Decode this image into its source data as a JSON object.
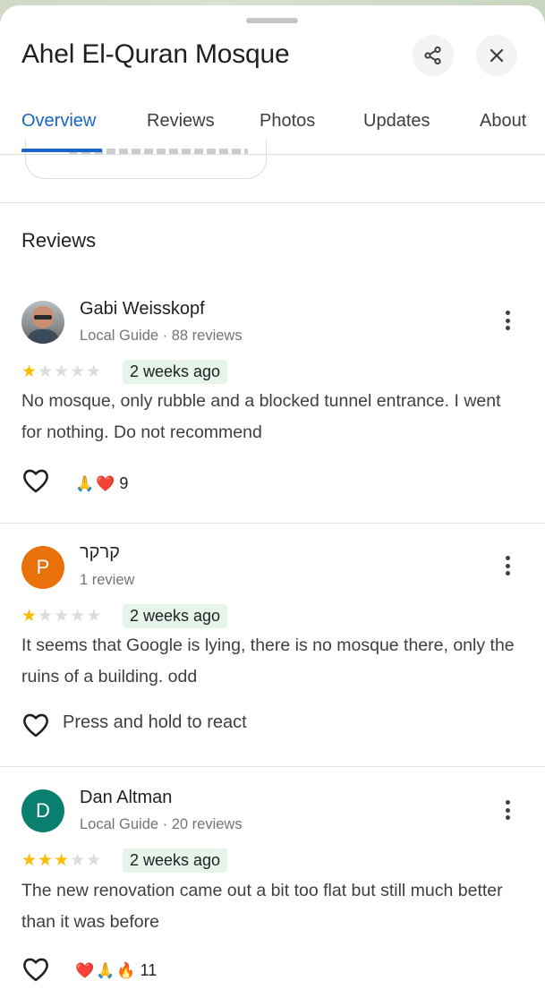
{
  "place": {
    "title": "Ahel El-Quran Mosque"
  },
  "tabs": [
    {
      "label": "Overview",
      "active": true
    },
    {
      "label": "Reviews",
      "active": false
    },
    {
      "label": "Photos",
      "active": false
    },
    {
      "label": "Updates",
      "active": false
    },
    {
      "label": "About",
      "active": false
    }
  ],
  "section": {
    "title": "Reviews"
  },
  "colors": {
    "accent": "#1a64c8",
    "star": "#fbbc04",
    "badge_bg": "#e6f4ea"
  },
  "reviews": [
    {
      "name": "Gabi Weisskopf",
      "meta": "Local Guide · 88 reviews",
      "rating": 1,
      "time": "2 weeks ago",
      "text": "No mosque, only rubble and a blocked tunnel entrance. I went for nothing. Do not recommend",
      "avatar": "photo",
      "reactions": [
        "🙏",
        "❤️"
      ],
      "reaction_count": "9"
    },
    {
      "name": "קרקר",
      "meta": "1 review",
      "rating": 1,
      "time": "2 weeks ago",
      "text": "It seems that Google is lying, there is no mosque there, only the ruins of a building. odd",
      "avatar_letter": "P",
      "avatar_color": "#e8710a",
      "react_prompt": "Press and hold to react"
    },
    {
      "name": "Dan Altman",
      "meta": "Local Guide · 20 reviews",
      "rating": 3,
      "time": "2 weeks ago",
      "text": "The new renovation came out a bit too flat but still much better than it was before",
      "avatar_letter": "D",
      "avatar_color": "#0b7f6f",
      "reactions": [
        "❤️",
        "🙏",
        "🔥"
      ],
      "reaction_count": "11"
    }
  ],
  "icons": {
    "share": "share-icon",
    "close": "close-icon",
    "more": "more-vert-icon",
    "heart": "heart-outline-icon"
  }
}
